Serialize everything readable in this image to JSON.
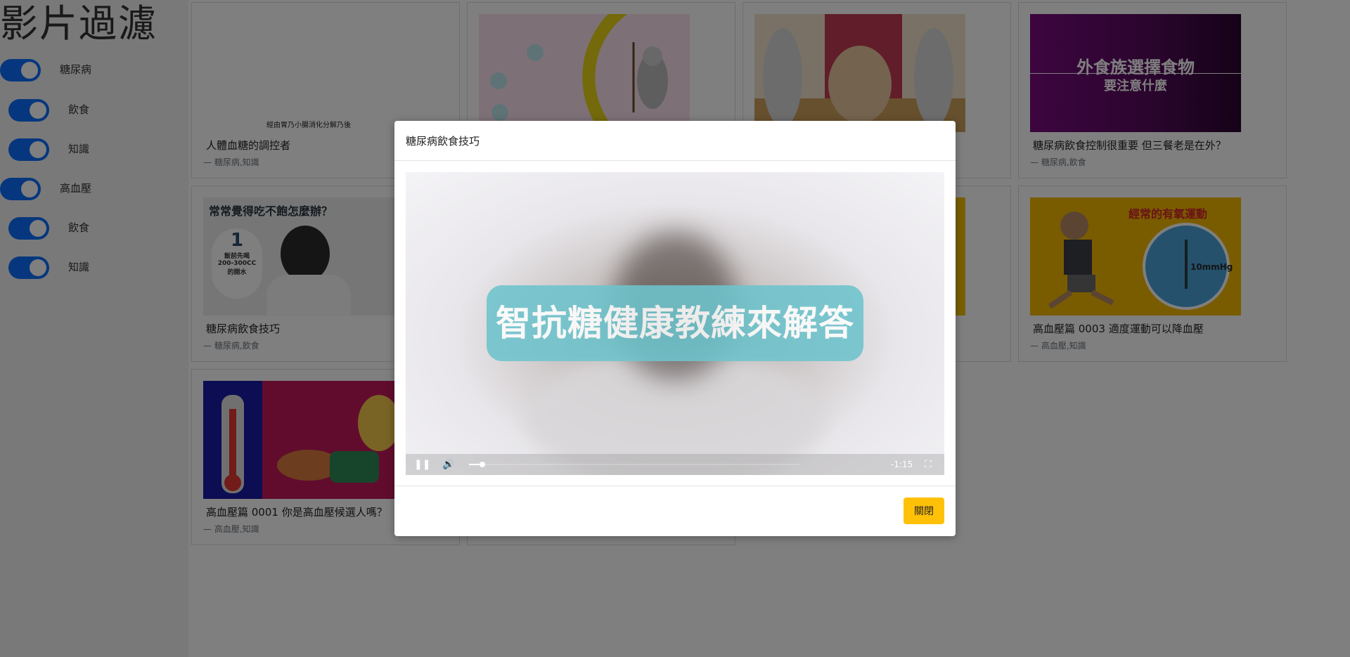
{
  "sidebar": {
    "title": "影片過濾",
    "filters": [
      {
        "label": "糖尿病",
        "checked": true
      },
      {
        "label": "飲食",
        "checked": true
      },
      {
        "label": "知識",
        "checked": true
      },
      {
        "label": "高血壓",
        "checked": true
      },
      {
        "label": "飲食",
        "checked": true
      },
      {
        "label": "知識",
        "checked": true
      }
    ]
  },
  "cards": [
    {
      "title": "人體血糖的調控者",
      "tags": "— 糖尿病,知識",
      "thumb_text": "經由胃乃小腸消化分解乃後"
    },
    {
      "title": "",
      "tags": ""
    },
    {
      "title": "",
      "tags": ""
    },
    {
      "title": "糖尿病飲食控制很重要 但三餐老是在外？",
      "tags": "— 糖尿病,飲食",
      "thumb_text": "外食族選擇食物",
      "thumb_subtext": "要注意什麼"
    },
    {
      "title": "糖尿病飲食技巧",
      "tags": "— 糖尿病,飲食",
      "thumb_text": "常常覺得吃不飽怎麼辦？",
      "thumb_sub": [
        "飯前先喝",
        "200-300CC",
        "的開水"
      ],
      "thumb_number": "1"
    },
    {
      "title": "",
      "tags": ""
    },
    {
      "title": "",
      "tags": ""
    },
    {
      "title": "高血壓篇 0003 適度運動可以降血壓",
      "tags": "— 高血壓,知識",
      "thumb_text": "經常的有氧運動",
      "thumb_gauge": "10mmHg"
    },
    {
      "title": "高血壓篇 0001 你是高血壓候選人嗎？",
      "tags": "— 高血壓,知識"
    },
    {
      "title": "",
      "tags": ""
    }
  ],
  "modal": {
    "title": "糖尿病飲食技巧",
    "caption": "智抗糖健康教練來解答",
    "time_remaining": "-1:15",
    "progress": 0.04,
    "close_label": "關閉"
  },
  "colors": {
    "toggle": "#0d6efd",
    "close_button": "#ffc107",
    "caption_bg": "#6ec4cd"
  }
}
